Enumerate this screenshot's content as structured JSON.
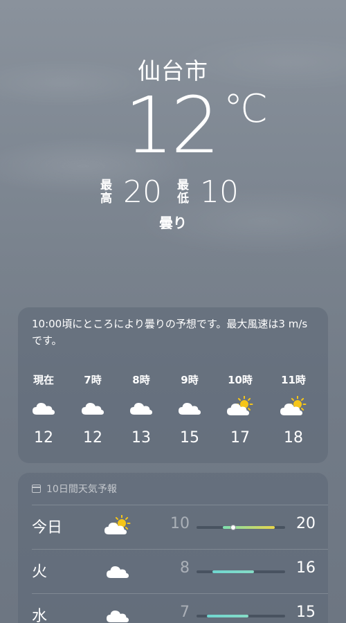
{
  "header": {
    "city": "仙台市",
    "temperature": "12",
    "unit": "°C",
    "high_label_top": "最",
    "high_label_bottom": "高",
    "high": "20",
    "low_label_top": "最",
    "low_label_bottom": "低",
    "low": "10",
    "condition": "曇り"
  },
  "hourly": {
    "summary": "10:00頃にところにより曇りの予想です。最大風速は3 m/s です。",
    "hours": [
      {
        "label": "現在",
        "icon": "cloud-icon",
        "temp": "12"
      },
      {
        "label": "7時",
        "icon": "cloud-icon",
        "temp": "12"
      },
      {
        "label": "8時",
        "icon": "cloud-icon",
        "temp": "13"
      },
      {
        "label": "9時",
        "icon": "cloud-icon",
        "temp": "15"
      },
      {
        "label": "10時",
        "icon": "partly-sunny-icon",
        "temp": "17"
      },
      {
        "label": "11時",
        "icon": "partly-sunny-icon",
        "temp": "18"
      }
    ]
  },
  "daily": {
    "header": "10日間天気予報",
    "header_icon": "calendar-icon",
    "range_min": 5,
    "range_max": 22,
    "days": [
      {
        "name": "今日",
        "icon": "partly-sunny-icon",
        "low": "10",
        "high": "20",
        "current": 12,
        "colors": [
          "#7ee0b0",
          "#e8d64a"
        ]
      },
      {
        "name": "火",
        "icon": "cloud-icon",
        "low": "8",
        "high": "16",
        "colors": [
          "#6fd6d0",
          "#86dcc6"
        ]
      },
      {
        "name": "水",
        "icon": "cloud-icon",
        "low": "7",
        "high": "15",
        "colors": [
          "#6fd6d0",
          "#86dcc6"
        ]
      }
    ]
  },
  "colors": {
    "sun": "#f5c518",
    "cloud": "#ffffff"
  }
}
